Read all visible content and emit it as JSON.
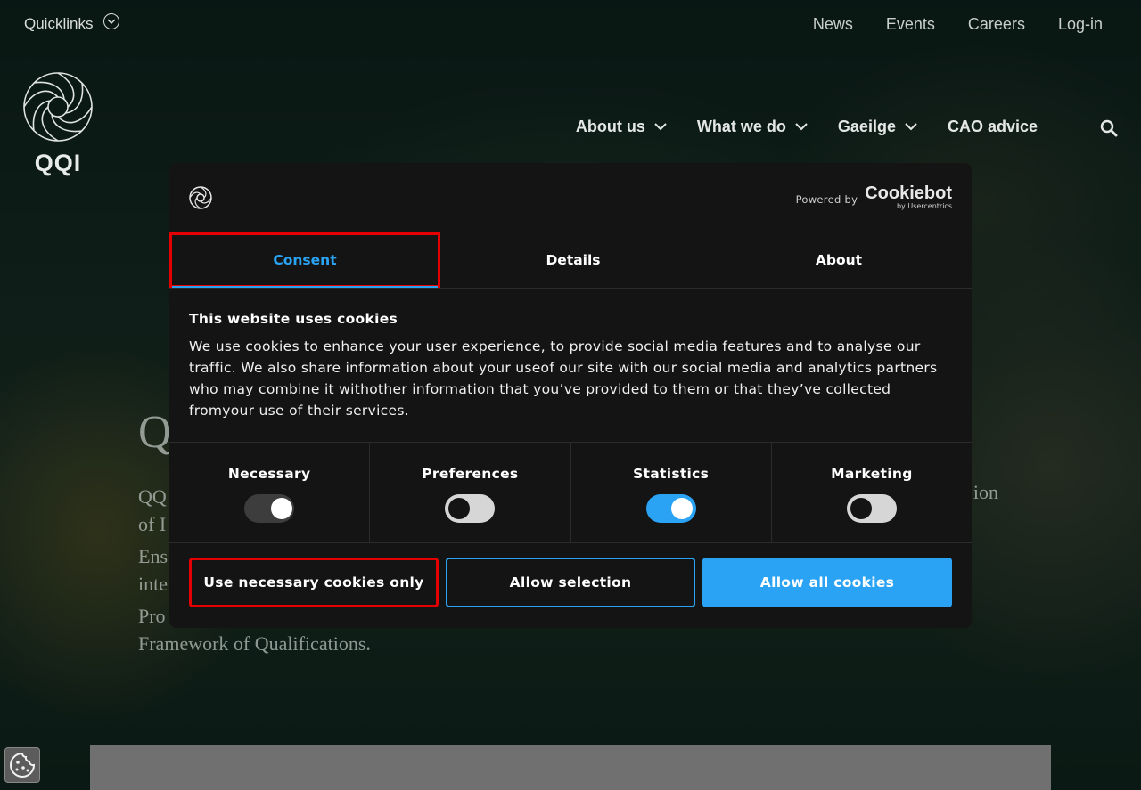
{
  "topbar": {
    "quicklinks_label": "Quicklinks",
    "links": [
      "News",
      "Events",
      "Careers",
      "Log-in"
    ]
  },
  "logo": {
    "text": "QQI"
  },
  "mainnav": {
    "items": [
      "About us",
      "What we do",
      "Gaeilge",
      "CAO advice"
    ]
  },
  "hero": {
    "title_visible": "Q",
    "p1_start": "QQ",
    "p1_line2": "of I",
    "p1_end": "ion",
    "p2_line1": "Ens",
    "p2_line2": "inte",
    "p3_line1": "Pro",
    "p3_line2": "Framework of Qualifications."
  },
  "dialog": {
    "powered_by": "Powered by",
    "brand": "Cookiebot",
    "brand_sub": "by Usercentrics",
    "tabs": [
      "Consent",
      "Details",
      "About"
    ],
    "title": "This website uses cookies",
    "text": "We use cookies to enhance your user experience, to provide social media features and to analyse our traffic. We also share information about your useof our site with our social media and analytics partners who may combine it withother information that you’ve provided to them or that they’ve collected fromyour use of their services.",
    "toggles": [
      {
        "label": "Necessary",
        "state": "disabled-on"
      },
      {
        "label": "Preferences",
        "state": "off"
      },
      {
        "label": "Statistics",
        "state": "on"
      },
      {
        "label": "Marketing",
        "state": "off"
      }
    ],
    "buttons": {
      "necessary": "Use necessary cookies only",
      "selection": "Allow selection",
      "all": "Allow all cookies"
    }
  },
  "colors": {
    "accent": "#2ba3f4",
    "highlight": "#e50000",
    "dialog_bg": "#141414"
  }
}
